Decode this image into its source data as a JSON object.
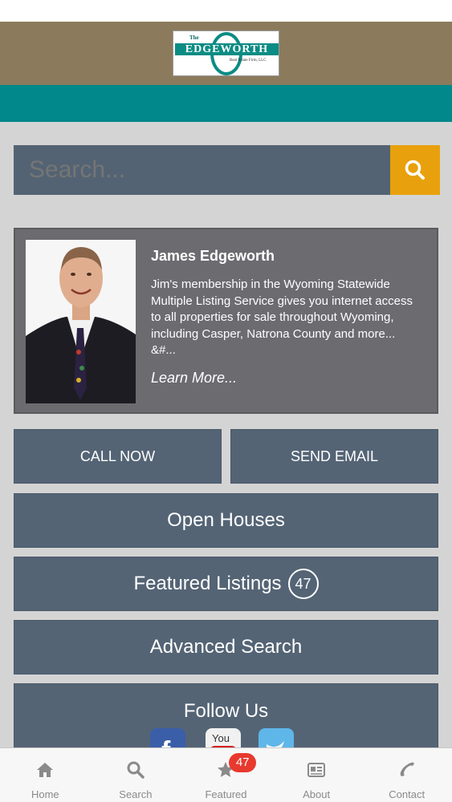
{
  "header": {
    "logo": {
      "the": "The",
      "name": "EDGEWORTH",
      "subtitle": "Real Estate Firm, LLC"
    }
  },
  "search": {
    "placeholder": "Search...",
    "icon": "search-icon"
  },
  "agent": {
    "name": "James Edgeworth",
    "bio": "Jim's membership in the Wyoming Statewide Multiple Listing Service gives you internet access to all properties for sale throughout Wyoming, including Casper, Natrona County and more... &#...",
    "learn_more": "Learn More..."
  },
  "actions": {
    "call_now": "CALL NOW",
    "send_email": "SEND EMAIL",
    "open_houses": "Open Houses",
    "featured_listings": "Featured Listings",
    "featured_count": "47",
    "advanced_search": "Advanced Search",
    "follow_us": "Follow Us"
  },
  "social": [
    "facebook-icon",
    "youtube-icon",
    "twitter-icon"
  ],
  "tabbar": {
    "items": [
      {
        "label": "Home",
        "icon": "home-icon"
      },
      {
        "label": "Search",
        "icon": "search-icon"
      },
      {
        "label": "Featured",
        "icon": "star-icon",
        "badge": "47"
      },
      {
        "label": "About",
        "icon": "id-card-icon"
      },
      {
        "label": "Contact",
        "icon": "phone-icon"
      }
    ]
  },
  "colors": {
    "header_brown": "#8b7b5c",
    "teal": "#00888a",
    "button_slate": "#546475",
    "search_orange": "#e8a10c",
    "badge_red": "#e8392e"
  }
}
